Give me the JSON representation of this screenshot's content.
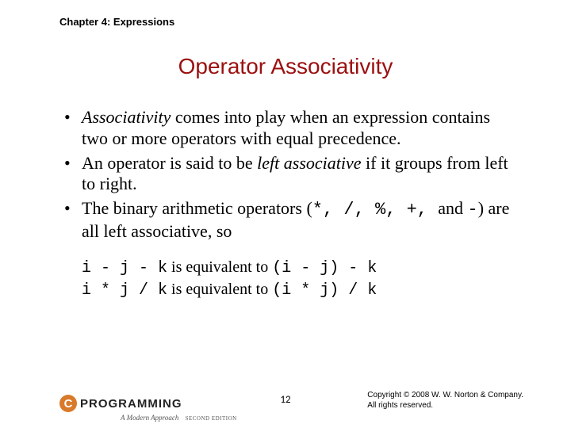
{
  "header": "Chapter 4: Expressions",
  "title": "Operator Associativity",
  "bullets": [
    {
      "pre": "",
      "em": "Associativity",
      "post": " comes into play when an expression contains two or more operators with equal precedence."
    },
    {
      "pre": "An operator is said to be ",
      "em": "left associative",
      "post": " if it groups from left to right."
    },
    {
      "pre": "The binary arithmetic operators (",
      "ops": "*, /, %, +, ",
      "op_last": "-",
      "pre2": " and ",
      "post": ") are all left associative, so"
    }
  ],
  "examples": [
    {
      "lhs": "i - j - k",
      "mid": " is equivalent to ",
      "rhs": "(i - j) - k"
    },
    {
      "lhs": "i * j / k",
      "mid": " is equivalent to ",
      "rhs": "(i * j) / k"
    }
  ],
  "footer": {
    "logo_letter": "C",
    "logo_word": "PROGRAMMING",
    "logo_sub": "A Modern Approach",
    "logo_edition": "SECOND EDITION",
    "page": "12",
    "copyright1": "Copyright © 2008 W. W. Norton & Company.",
    "copyright2": "All rights reserved."
  }
}
